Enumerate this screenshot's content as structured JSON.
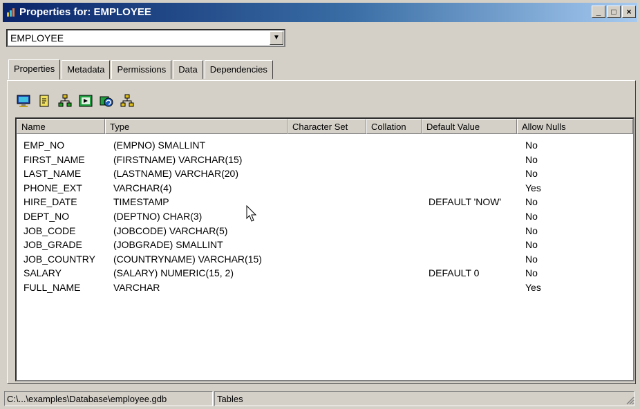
{
  "window": {
    "title": "Properties for: EMPLOYEE"
  },
  "object_selector": {
    "value": "EMPLOYEE"
  },
  "tabs": [
    {
      "label": "Properties",
      "active": true
    },
    {
      "label": "Metadata",
      "active": false
    },
    {
      "label": "Permissions",
      "active": false
    },
    {
      "label": "Data",
      "active": false
    },
    {
      "label": "Dependencies",
      "active": false
    }
  ],
  "toolbar": {
    "icons": [
      "monitor-icon",
      "document-icon",
      "hierarchy-icon",
      "chart-icon",
      "refresh-icon",
      "tree-icon"
    ]
  },
  "table": {
    "columns": [
      "Name",
      "Type",
      "Character Set",
      "Collation",
      "Default Value",
      "Allow Nulls"
    ],
    "rows": [
      {
        "name": "EMP_NO",
        "type": "(EMPNO) SMALLINT",
        "charset": "",
        "collation": "",
        "default": "",
        "nulls": "No"
      },
      {
        "name": "FIRST_NAME",
        "type": "(FIRSTNAME) VARCHAR(15)",
        "charset": "",
        "collation": "",
        "default": "",
        "nulls": "No"
      },
      {
        "name": "LAST_NAME",
        "type": "(LASTNAME) VARCHAR(20)",
        "charset": "",
        "collation": "",
        "default": "",
        "nulls": "No"
      },
      {
        "name": "PHONE_EXT",
        "type": "VARCHAR(4)",
        "charset": "",
        "collation": "",
        "default": "",
        "nulls": "Yes"
      },
      {
        "name": "HIRE_DATE",
        "type": "TIMESTAMP",
        "charset": "",
        "collation": "",
        "default": "DEFAULT 'NOW'",
        "nulls": "No"
      },
      {
        "name": "DEPT_NO",
        "type": "(DEPTNO) CHAR(3)",
        "charset": "",
        "collation": "",
        "default": "",
        "nulls": "No"
      },
      {
        "name": "JOB_CODE",
        "type": "(JOBCODE) VARCHAR(5)",
        "charset": "",
        "collation": "",
        "default": "",
        "nulls": "No"
      },
      {
        "name": "JOB_GRADE",
        "type": "(JOBGRADE) SMALLINT",
        "charset": "",
        "collation": "",
        "default": "",
        "nulls": "No"
      },
      {
        "name": "JOB_COUNTRY",
        "type": "(COUNTRYNAME) VARCHAR(15)",
        "charset": "",
        "collation": "",
        "default": "",
        "nulls": "No"
      },
      {
        "name": "SALARY",
        "type": "(SALARY) NUMERIC(15, 2)",
        "charset": "",
        "collation": "",
        "default": "DEFAULT 0",
        "nulls": "No"
      },
      {
        "name": "FULL_NAME",
        "type": "VARCHAR",
        "charset": "",
        "collation": "",
        "default": "",
        "nulls": "Yes"
      }
    ]
  },
  "statusbar": {
    "path": "C:\\...\\examples\\Database\\employee.gdb",
    "section": "Tables"
  }
}
